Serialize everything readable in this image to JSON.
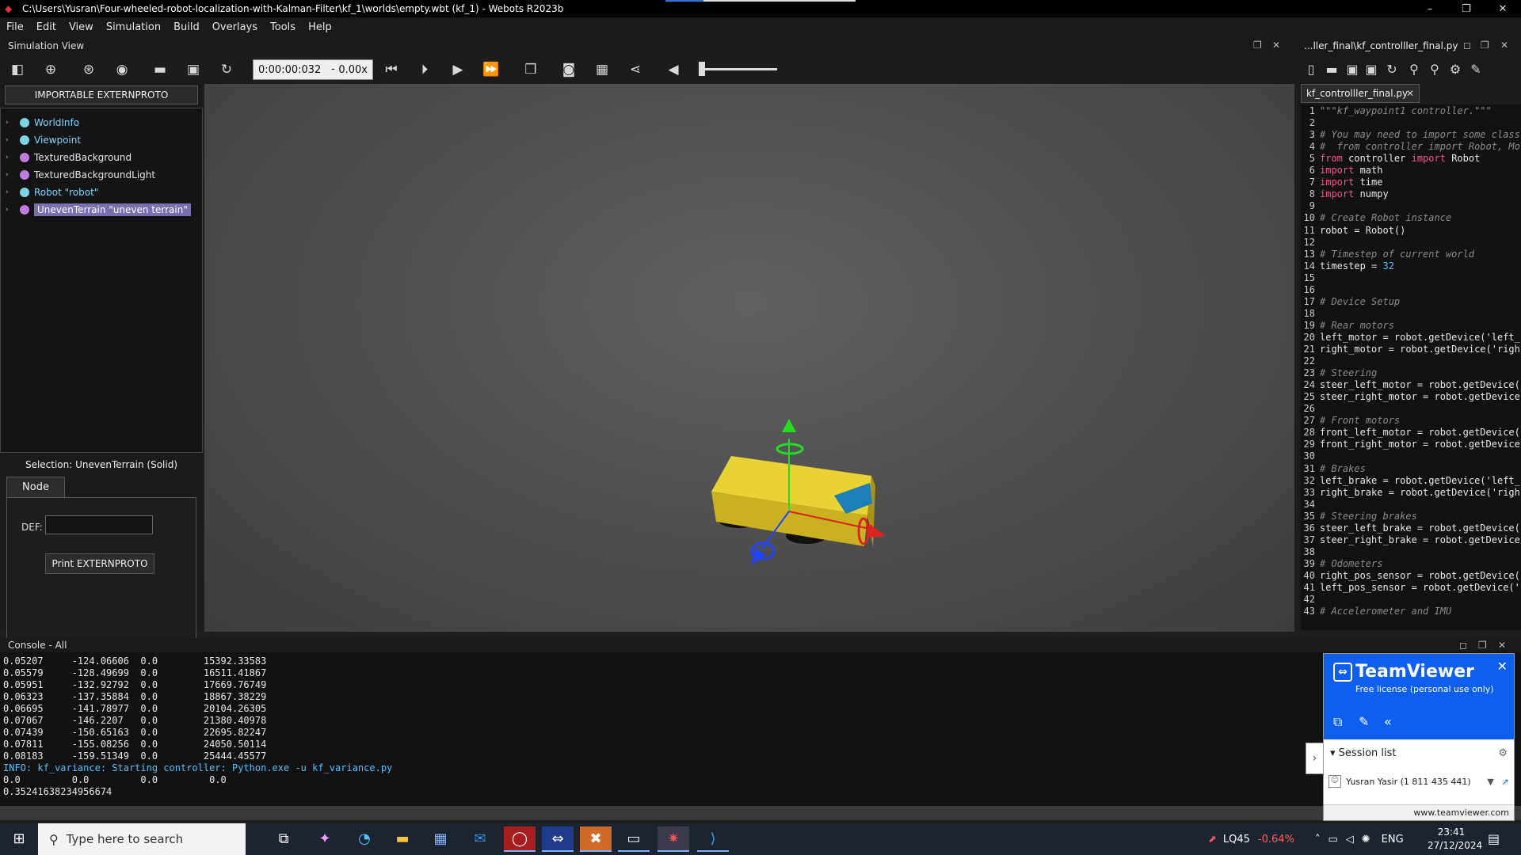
{
  "window": {
    "title": "C:\\Users\\Yusran\\Four-wheeled-robot-localization-with-Kalman-Filter\\kf_1\\worlds\\empty.wbt (kf_1) - Webots R2023b",
    "minimize": "–",
    "maximize": "❐",
    "close": "✕"
  },
  "menu": [
    "File",
    "Edit",
    "View",
    "Simulation",
    "Build",
    "Overlays",
    "Tools",
    "Help"
  ],
  "sim_view": {
    "title": "Simulation View",
    "time": "0:00:00:032",
    "separator": "-",
    "speed": "0.00x",
    "volume_fraction": 0.02
  },
  "scene": {
    "import_button": "IMPORTABLE EXTERNPROTO",
    "items": [
      {
        "label": "WorldInfo",
        "color": "#7fd3e6",
        "text_color": "#7fd3ff"
      },
      {
        "label": "Viewpoint",
        "color": "#7fd3e6",
        "text_color": "#7fd3ff"
      },
      {
        "label": "TexturedBackground",
        "color": "#c07ae0",
        "text_color": "#e6e6e6"
      },
      {
        "label": "TexturedBackgroundLight",
        "color": "#c07ae0",
        "text_color": "#e6e6e6"
      },
      {
        "label": "Robot \"robot\"",
        "color": "#7fd3e6",
        "text_color": "#7fd3ff"
      },
      {
        "label": "UnevenTerrain \"uneven terrain\"",
        "color": "#c07ae0",
        "text_color": "#ffffff"
      }
    ],
    "selection": "Selection: UnevenTerrain (Solid)",
    "node_tab": "Node",
    "def_label": "DEF:",
    "def_value": "",
    "print_button": "Print EXTERNPROTO"
  },
  "editor": {
    "path_title": "...ller_final\\kf_controlller_final.py",
    "tab": "kf_controlller_final.py",
    "lines": [
      {
        "n": "1",
        "html": "<span class=\"cmt\">\"\"\"kf_waypoint1 controller.\"\"\"</span>"
      },
      {
        "n": "2",
        "html": ""
      },
      {
        "n": "3",
        "html": "<span class=\"cmt\"># You may need to import some class</span>"
      },
      {
        "n": "4",
        "html": "<span class=\"cmt\">#  from controller import Robot, Mo</span>"
      },
      {
        "n": "5",
        "html": "<span class=\"kw\">from</span> controller <span class=\"kw\">import</span> Robot"
      },
      {
        "n": "6",
        "html": "<span class=\"kw\">import</span> math"
      },
      {
        "n": "7",
        "html": "<span class=\"kw\">import</span> time"
      },
      {
        "n": "8",
        "html": "<span class=\"kw\">import</span> numpy"
      },
      {
        "n": "9",
        "html": ""
      },
      {
        "n": "10",
        "html": "<span class=\"cmt\"># Create Robot instance</span>"
      },
      {
        "n": "11",
        "html": "robot = Robot()"
      },
      {
        "n": "12",
        "html": ""
      },
      {
        "n": "13",
        "html": "<span class=\"cmt\"># Timestep of current world</span>"
      },
      {
        "n": "14",
        "html": "timestep = <span class=\"num\">32</span>"
      },
      {
        "n": "15",
        "html": ""
      },
      {
        "n": "16",
        "html": ""
      },
      {
        "n": "17",
        "html": "<span class=\"cmt\"># Device Setup</span>"
      },
      {
        "n": "18",
        "html": ""
      },
      {
        "n": "19",
        "html": "<span class=\"cmt\"># Rear motors</span>"
      },
      {
        "n": "20",
        "html": "left_motor = robot.getDevice('left_"
      },
      {
        "n": "21",
        "html": "right_motor = robot.getDevice('righ"
      },
      {
        "n": "22",
        "html": ""
      },
      {
        "n": "23",
        "html": "<span class=\"cmt\"># Steering</span>"
      },
      {
        "n": "24",
        "html": "steer_left_motor = robot.getDevice("
      },
      {
        "n": "25",
        "html": "steer_right_motor = robot.getDevice"
      },
      {
        "n": "26",
        "html": ""
      },
      {
        "n": "27",
        "html": "<span class=\"cmt\"># Front motors</span>"
      },
      {
        "n": "28",
        "html": "front_left_motor = robot.getDevice("
      },
      {
        "n": "29",
        "html": "front_right_motor = robot.getDevice"
      },
      {
        "n": "30",
        "html": ""
      },
      {
        "n": "31",
        "html": "<span class=\"cmt\"># Brakes</span>"
      },
      {
        "n": "32",
        "html": "left_brake = robot.getDevice('left_"
      },
      {
        "n": "33",
        "html": "right_brake = robot.getDevice('righ"
      },
      {
        "n": "34",
        "html": ""
      },
      {
        "n": "35",
        "html": "<span class=\"cmt\"># Steering brakes</span>"
      },
      {
        "n": "36",
        "html": "steer_left_brake = robot.getDevice("
      },
      {
        "n": "37",
        "html": "steer_right_brake = robot.getDevice"
      },
      {
        "n": "38",
        "html": ""
      },
      {
        "n": "39",
        "html": "<span class=\"cmt\"># Odometers</span>"
      },
      {
        "n": "40",
        "html": "right_pos_sensor = robot.getDevice("
      },
      {
        "n": "41",
        "html": "left_pos_sensor = robot.getDevice('"
      },
      {
        "n": "42",
        "html": ""
      },
      {
        "n": "43",
        "html": "<span class=\"cmt\"># Accelerometer and IMU</span>"
      }
    ]
  },
  "console": {
    "title": "Console - All",
    "rows": [
      "0.05207     -124.06606  0.0        15392.33583",
      "0.05579     -128.49699  0.0        16511.41867",
      "0.05951     -132.92792  0.0        17669.76749",
      "0.06323     -137.35884  0.0        18867.38229",
      "0.06695     -141.78977  0.0        20104.26305",
      "0.07067     -146.2207   0.0        21380.40978",
      "0.07439     -150.65163  0.0        22695.82247",
      "0.07811     -155.08256  0.0        24050.50114",
      "0.08183     -159.51349  0.0        25444.45577"
    ],
    "info": "INFO: kf_variance: Starting controller: Python.exe -u kf_variance.py",
    "row_zero": "0.0         0.0         0.0         0.0",
    "last": "0.35241638234956674"
  },
  "teamviewer": {
    "logo": "TeamViewer",
    "subtitle": "Free license (personal use only)",
    "session_list": "Session list",
    "user": "Yusran Yasir (1 811 435 441)",
    "url": "www.teamviewer.com"
  },
  "taskbar": {
    "search_placeholder": "Type here to search",
    "stock_name": "LQ45",
    "stock_change": "-0.64%",
    "lang": "ENG",
    "time": "23:41",
    "date": "27/12/2024"
  }
}
